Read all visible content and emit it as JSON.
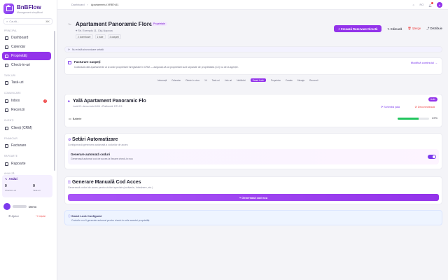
{
  "app": {
    "name": "BnBFlow",
    "subtitle": "Management simplificat"
  },
  "search": {
    "placeholder": "Caută...",
    "shortcut": "⌘K"
  },
  "sidebar": {
    "sections": [
      {
        "label": "PRINCIPAL"
      },
      {
        "label": "TASK-URI"
      },
      {
        "label": "COMUNICARE"
      },
      {
        "label": "CLIENȚI"
      },
      {
        "label": "FINANCIAR"
      },
      {
        "label": "RAPOARTE"
      },
      {
        "label": "ANALIZĂ"
      }
    ],
    "items": [
      {
        "label": "Dashboard"
      },
      {
        "label": "Calendar"
      },
      {
        "label": "Proprietăți"
      },
      {
        "label": "Check-in-uri"
      },
      {
        "label": "Task-uri"
      },
      {
        "label": "Inbox",
        "badge": "2"
      },
      {
        "label": "Recenzii"
      },
      {
        "label": "Clienți (CRM)"
      },
      {
        "label": "Facturare"
      },
      {
        "label": "Rapoarte"
      }
    ],
    "activity": {
      "title": "Astăzi",
      "checkins_value": "0",
      "checkins_label": "Check-in-uri",
      "checkouts_value": "0",
      "checkouts_label": "Task-uri"
    },
    "user": {
      "name": "Demo"
    },
    "footer": {
      "help": "Ajutor",
      "logout": "Ieșire"
    }
  },
  "topbar": {
    "breadcrumb_root": "Dashboard",
    "breadcrumb_sep": "›",
    "breadcrumb_current": "Apartamentul XRB7v51",
    "lang": "RO",
    "avatar_initial": "A"
  },
  "header": {
    "back_icon": "arrow-left-icon",
    "title": "Apartament Panoramic Floreasca",
    "badge": "Proprietate",
    "address": "Str. Exemplu 11, Cluj-Napoca",
    "tags": [
      "2 dormitoare",
      "1 baie",
      "4 oaspeți"
    ],
    "primary_action": "Creează Rezervare Directă",
    "edit": "Editează",
    "delete": "Șterge",
    "share": "Distribuie"
  },
  "sync_notice": "Nu există sincronizare setată",
  "info_card": {
    "title": "Facturare oaspeți",
    "desc": "Contează câte apartamente ai și unde proprietarii înregistrate în CRM — asigurați-vă că proprietarii sunt separate de proprietatea (CJ) nu de la agenție.",
    "link": "Modifică conținutul →"
  },
  "tabs": [
    "Informații",
    "Calendar",
    "Oferte în vizor",
    "14",
    "Task-uri",
    "Link-uri",
    "Notificări",
    "Smart Lock",
    "Proprietar",
    "Canale",
    "Mesaje",
    "Recenzii"
  ],
  "lock_card": {
    "title": "Yală Apartament Panoramic Flo",
    "subtitle": "Lock ID: demo-lock-0404 • Platformă: DTL2.5",
    "status": "Activ",
    "schedule": "Schimbă yala",
    "disconnect": "Deconectează",
    "battery_label": "Baterie",
    "battery_value": "67%",
    "battery_level": 67
  },
  "auto_card": {
    "title": "Setări Automatizare",
    "subtitle": "Configurează generarea automată a codurilor de acces",
    "toggle_title": "Generare automată coduri",
    "toggle_desc": "Generează automat cod de acces la fiecare check-in nou",
    "toggle_on": true
  },
  "gen_card": {
    "title": "Generare Manuală Cod Acces",
    "subtitle": "Generează coduri de acces pentru vizitori speciale (curățenie, întreținere, etc.)",
    "button": "Generează cod nou"
  },
  "config_card": {
    "title": "Smart Lock Configurat",
    "desc": "Codurile vor fi generate automat pentru check-in-urile acestei proprietăți."
  },
  "colors": {
    "accent": "#9333ea",
    "danger": "#ef4444",
    "success": "#22c55e"
  }
}
